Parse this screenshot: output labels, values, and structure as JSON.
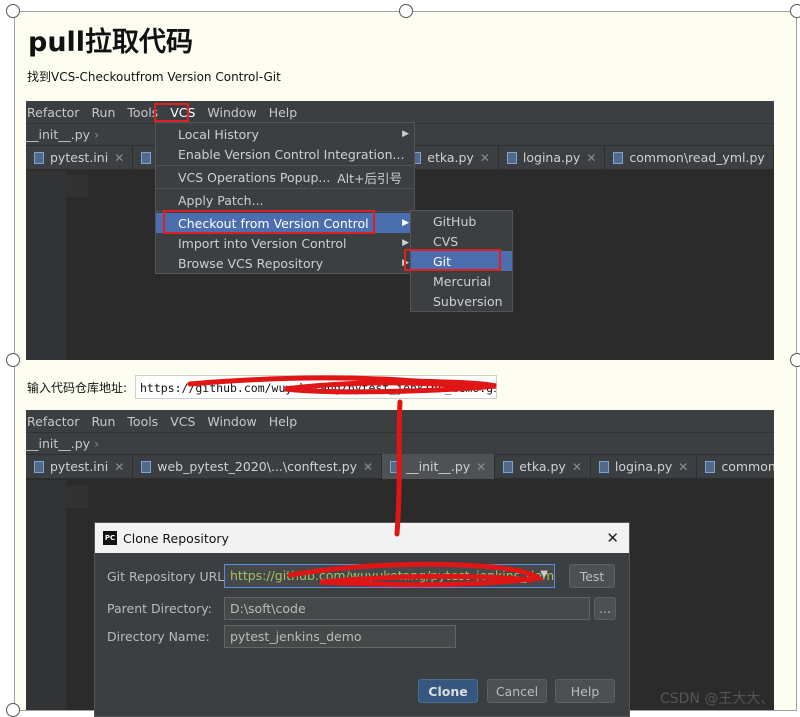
{
  "page": {
    "heading": "pull拉取代码",
    "step1": "找到VCS-Checkoutfrom Version Control-Git",
    "url_label": "输入代码仓库地址:",
    "url_value": "https://github.com/wuyuketang/pytest_jenkins_demo.git",
    "watermark": "CSDN @王大大、"
  },
  "ide": {
    "menu": [
      "Refactor",
      "Run",
      "Tools",
      "VCS",
      "Window",
      "Help"
    ],
    "breadcrumb": "__init__.py",
    "tabs1": [
      {
        "label": "pytest.ini"
      },
      {
        "label": "v"
      },
      {
        "label": "y"
      },
      {
        "label": "etka.py"
      },
      {
        "label": "logina.py"
      },
      {
        "label": "common\\read_yml.py"
      }
    ],
    "tabs2": [
      {
        "label": "pytest.ini"
      },
      {
        "label": "web_pytest_2020\\...\\conftest.py"
      },
      {
        "label": "__init__.py"
      },
      {
        "label": "etka.py"
      },
      {
        "label": "logina.py"
      },
      {
        "label": "common\\read_yml.py"
      }
    ]
  },
  "vcs_menu": {
    "items": [
      {
        "label": "Local History",
        "submenu": true
      },
      {
        "label": "Enable Version Control Integration..."
      },
      {
        "label": "VCS Operations Popup...",
        "shortcut": "Alt+后引号"
      },
      {
        "label": "Apply Patch..."
      },
      {
        "label": "Checkout from Version Control",
        "submenu": true,
        "selected": true
      },
      {
        "label": "Import into Version Control",
        "submenu": true
      },
      {
        "label": "Browse VCS Repository",
        "submenu": true
      }
    ],
    "checkout_submenu": [
      "GitHub",
      "CVS",
      "Git",
      "Mercurial",
      "Subversion"
    ],
    "selected_sub": "Git"
  },
  "dialog": {
    "title": "Clone Repository",
    "close": "✕",
    "git_url_label": "Git Repository URL:",
    "git_url_value": "https://github.com/wuyuketang/pytest_jenkins_demo.git",
    "parent_label": "Parent Directory:",
    "parent_value": "D:\\soft\\code",
    "browse": "...",
    "dirname_label": "Directory Name:",
    "dirname_value": "pytest_jenkins_demo",
    "test_btn": "Test",
    "clone_btn": "Clone",
    "cancel_btn": "Cancel",
    "help_btn": "Help"
  },
  "colors": {
    "annotation": "#e02020",
    "ide_bg": "#2b2b2b",
    "menu_bg": "#3c3f41",
    "selection": "#4b6eaf"
  }
}
